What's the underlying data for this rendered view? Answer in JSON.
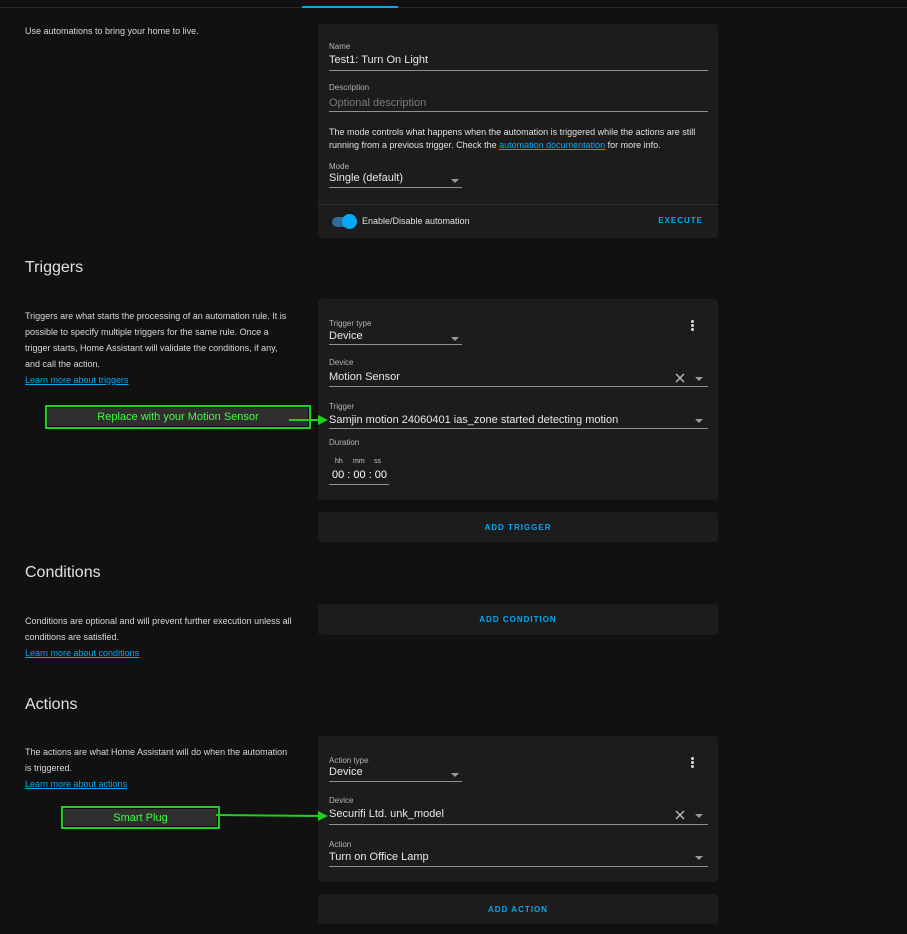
{
  "intro_text": "Use automations to bring your home to live.",
  "details": {
    "name_label": "Name",
    "name_value": "Test1: Turn On Light",
    "description_label": "Description",
    "description_placeholder": "Optional description",
    "mode_help_before": "The mode controls what happens when the automation is triggered while the actions are still running from a previous trigger. Check the ",
    "mode_help_link": "automation documentation",
    "mode_help_after": " for more info.",
    "mode_label": "Mode",
    "mode_value": "Single (default)",
    "toggle_label": "Enable/Disable automation",
    "toggle_on": true,
    "execute_label": "EXECUTE"
  },
  "triggers": {
    "title": "Triggers",
    "description": "Triggers are what starts the processing of an automation rule. It is possible to specify multiple triggers for the same rule. Once a trigger starts, Home Assistant will validate the conditions, if any, and call the action.",
    "learn_more": "Learn more about triggers",
    "trigger_type_label": "Trigger type",
    "trigger_type_value": "Device",
    "device_label": "Device",
    "device_value": "Motion Sensor",
    "trigger_label": "Trigger",
    "trigger_value": "Samjin motion 24060401 ias_zone started detecting motion",
    "duration_label": "Duration",
    "duration_units": [
      "hh",
      "mm",
      "ss"
    ],
    "duration_value": "00 : 00 : 00",
    "add_label": "ADD TRIGGER"
  },
  "conditions": {
    "title": "Conditions",
    "description": "Conditions are optional and will prevent further execution unless all conditions are satisfied.",
    "learn_more": "Learn more about conditions",
    "add_label": "ADD CONDITION"
  },
  "actions": {
    "title": "Actions",
    "description": "The actions are what Home Assistant will do when the automation is triggered.",
    "learn_more": "Learn more about actions",
    "action_type_label": "Action type",
    "action_type_value": "Device",
    "device_label": "Device",
    "device_value": "Securifi Ltd. unk_model",
    "action_label": "Action",
    "action_value": "Turn on Office Lamp",
    "add_label": "ADD ACTION"
  },
  "annotations": {
    "motion_sensor": "Replace with your Motion Sensor",
    "smart_plug": "Smart Plug"
  },
  "colors": {
    "accent": "#03a9f4",
    "background": "#111111",
    "card": "#1c1c1c",
    "annotation_green": "#1fd11f"
  }
}
